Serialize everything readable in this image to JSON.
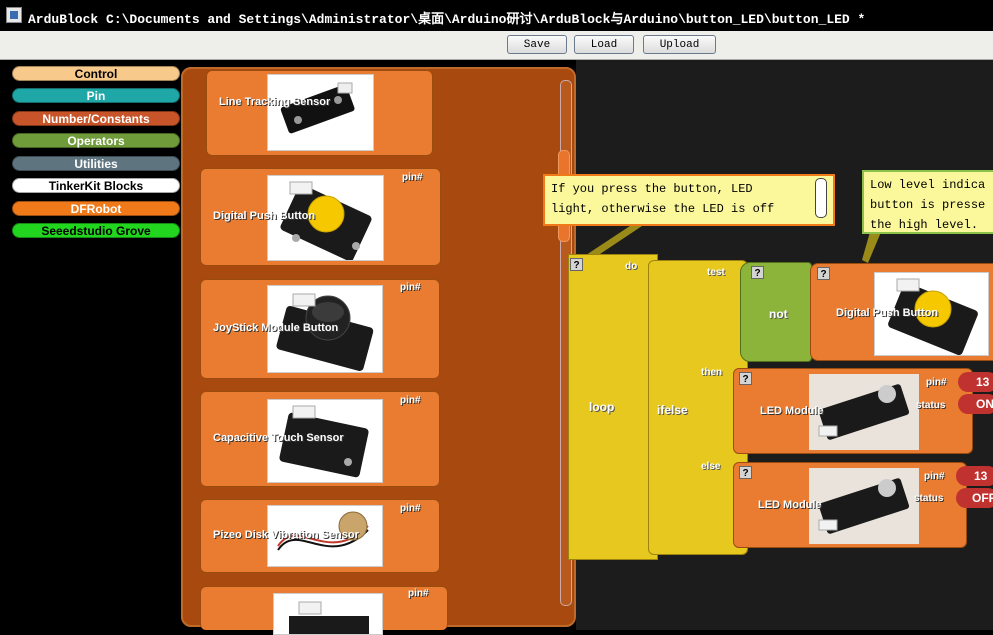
{
  "window": {
    "title": "ArduBlock C:\\Documents and Settings\\Administrator\\桌面\\Arduino研讨\\ArduBlock与Arduino\\button_LED\\button_LED *"
  },
  "toolbar": {
    "save_label": "Save",
    "load_label": "Load",
    "upload_label": "Upload"
  },
  "palette": {
    "categories": [
      {
        "label": "Control",
        "color": "#f7c98b",
        "text": "#000000"
      },
      {
        "label": "Pin",
        "color": "#1fa7a7",
        "text": "#ffffff"
      },
      {
        "label": "Number/Constants",
        "color": "#c8552a",
        "text": "#ffffff"
      },
      {
        "label": "Operators",
        "color": "#6f9b3a",
        "text": "#ffffff"
      },
      {
        "label": "Utilities",
        "color": "#5e7580",
        "text": "#ffffff"
      },
      {
        "label": "TinkerKit Blocks",
        "color": "#ffffff",
        "text": "#000000"
      },
      {
        "label": "DFRobot",
        "color": "#f07a1a",
        "text": "#ffffff"
      },
      {
        "label": "Seeedstudio Grove",
        "color": "#22d61f",
        "text": "#000000"
      }
    ]
  },
  "drawer": {
    "blocks": [
      {
        "label": "Line Tracking Sensor",
        "pin": "",
        "icon": "line-sensor-photo"
      },
      {
        "label": "Digital Push Button",
        "pin": "pin#",
        "icon": "push-button-photo"
      },
      {
        "label": "JoyStick Module Button",
        "pin": "pin#",
        "icon": "joystick-photo"
      },
      {
        "label": "Capacitive Touch Sensor",
        "pin": "pin#",
        "icon": "touch-sensor-photo"
      },
      {
        "label": "Pizeo Disk Vibration Sensor",
        "pin": "pin#",
        "icon": "piezo-photo"
      },
      {
        "label": "",
        "pin": "pin#",
        "icon": "module-photo"
      }
    ]
  },
  "canvas": {
    "comment1": "If you press the button, LED\nlight, otherwise the LED is off",
    "comment2": "Low level indica\nbutton is presse\nthe high level.",
    "loop": {
      "label": "loop",
      "do": "do"
    },
    "ifelse": {
      "label": "ifelse",
      "test": "test",
      "then": "then",
      "else": "else"
    },
    "not_label": "not",
    "button_block": "Digital Push Button",
    "led1": {
      "label": "LED Module",
      "pin": "pin#",
      "status": "status",
      "pin_value": "13",
      "status_value": "ON"
    },
    "led2": {
      "label": "LED Module",
      "pin": "pin#",
      "status": "status",
      "pin_value": "13",
      "status_value": "OFF"
    },
    "help_glyph": "?"
  }
}
